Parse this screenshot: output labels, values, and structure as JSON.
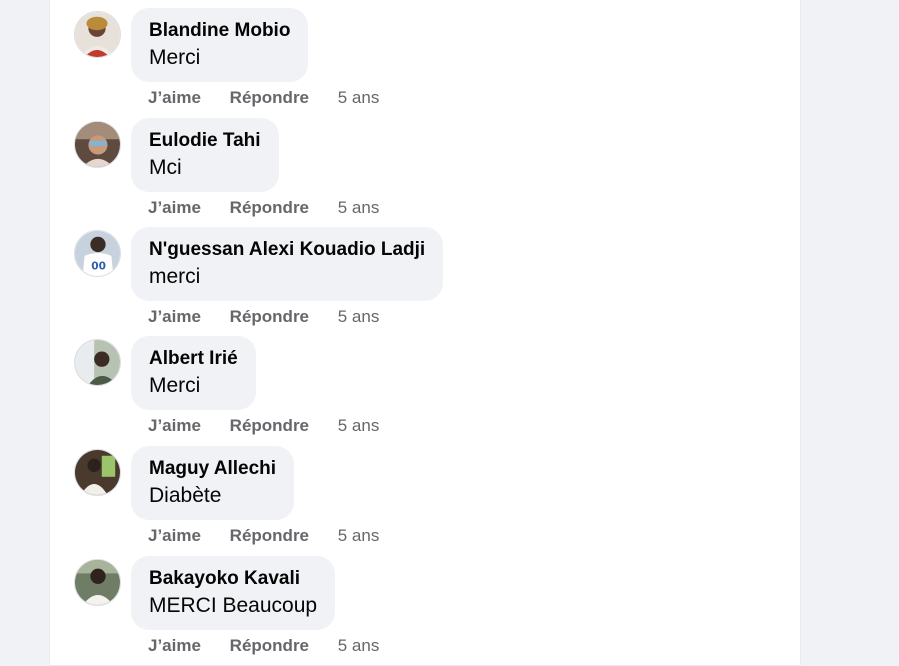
{
  "comments": [
    {
      "author": "Blandine Mobio",
      "text": "Merci",
      "like": "J’aime",
      "reply": "Répondre",
      "time": "5 ans",
      "avatar_color": "#c9b7a8"
    },
    {
      "author": "Eulodie Tahi",
      "text": "Mci",
      "like": "J’aime",
      "reply": "Répondre",
      "time": "5 ans",
      "avatar_color": "#8e6b58"
    },
    {
      "author": "N'guessan Alexi Kouadio Ladji",
      "text": "merci",
      "like": "J’aime",
      "reply": "Répondre",
      "time": "5 ans",
      "avatar_color": "#a9b8cc"
    },
    {
      "author": "Albert Irié",
      "text": "Merci",
      "like": "J’aime",
      "reply": "Répondre",
      "time": "5 ans",
      "avatar_color": "#6c7a6a"
    },
    {
      "author": "Maguy Allechi",
      "text": "Diabète",
      "like": "J’aime",
      "reply": "Répondre",
      "time": "5 ans",
      "avatar_color": "#5b4a3c"
    },
    {
      "author": "Bakayoko Kavali",
      "text": "MERCI Beaucoup",
      "like": "J’aime",
      "reply": "Répondre",
      "time": "5 ans",
      "avatar_color": "#7d8a78"
    }
  ]
}
